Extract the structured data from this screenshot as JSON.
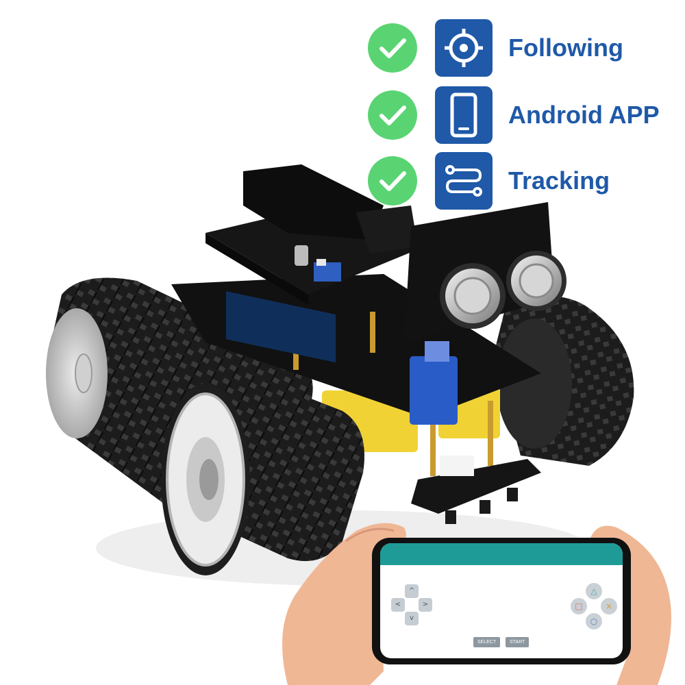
{
  "features": [
    {
      "label": "Following",
      "icon": "target-icon"
    },
    {
      "label": "Android APP",
      "icon": "smartphone-icon"
    },
    {
      "label": "Tracking",
      "icon": "route-icon"
    }
  ],
  "colors": {
    "check_green": "#5ad473",
    "feature_blue": "#1f59a8",
    "app_bar_teal": "#1e9b96"
  },
  "phone_app": {
    "dpad": {
      "up": "^",
      "down": "v",
      "left": "<",
      "right": ">"
    },
    "actions": {
      "triangle": "△",
      "square": "□",
      "cross": "×",
      "circle": "○"
    },
    "select_label": "SELECT",
    "start_label": "START"
  }
}
